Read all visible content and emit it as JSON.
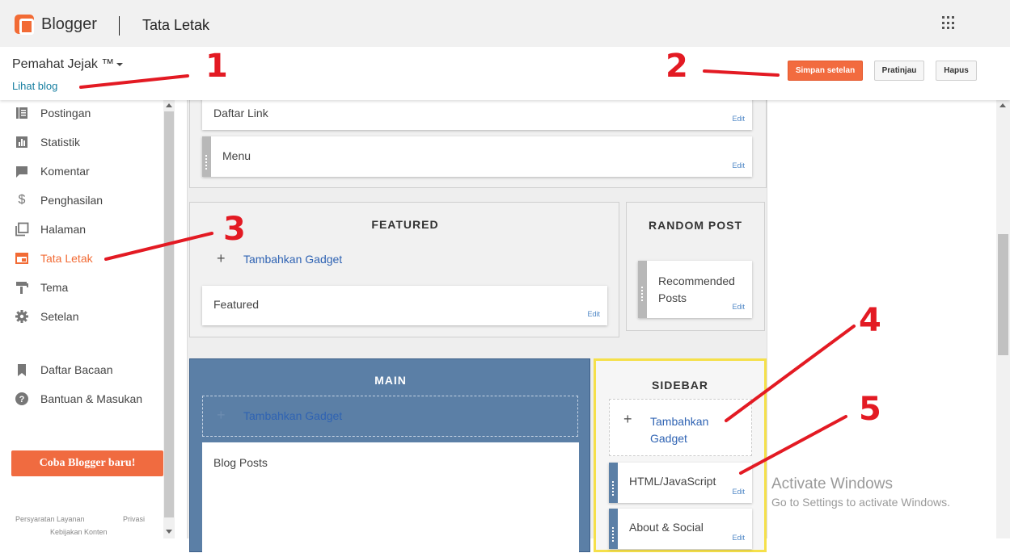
{
  "app": {
    "brand": "Blogger",
    "page_title": "Tata Letak"
  },
  "blog": {
    "name": "Pemahat Jejak ™",
    "view_link": "Lihat blog"
  },
  "actions": {
    "save": "Simpan setelan",
    "preview": "Pratinjau",
    "delete": "Hapus"
  },
  "nav": {
    "items": [
      {
        "label": "Postingan",
        "icon": "posts-icon"
      },
      {
        "label": "Statistik",
        "icon": "stats-icon"
      },
      {
        "label": "Komentar",
        "icon": "comments-icon"
      },
      {
        "label": "Penghasilan",
        "icon": "dollar-icon"
      },
      {
        "label": "Halaman",
        "icon": "pages-icon"
      },
      {
        "label": "Tata Letak",
        "icon": "layout-icon",
        "active": true
      },
      {
        "label": "Tema",
        "icon": "theme-icon"
      },
      {
        "label": "Setelan",
        "icon": "gear-icon"
      },
      {
        "label": "Daftar Bacaan",
        "icon": "bookmark-icon"
      },
      {
        "label": "Bantuan & Masukan",
        "icon": "help-icon"
      }
    ],
    "try_new": "Coba Blogger baru!",
    "footer": {
      "terms": "Persyaratan Layanan",
      "privacy": "Privasi",
      "content_policy": "Kebijakan Konten"
    }
  },
  "layout": {
    "top_gadgets": [
      {
        "label": "Daftar Link",
        "edit": "Edit"
      },
      {
        "label": "Menu",
        "edit": "Edit"
      }
    ],
    "featured": {
      "title": "FEATURED",
      "add": "Tambahkan Gadget",
      "gadget": "Featured",
      "edit": "Edit"
    },
    "random_post": {
      "title": "RANDOM POST",
      "gadget": "Recommended Posts",
      "edit": "Edit"
    },
    "main": {
      "title": "MAIN",
      "add": "Tambahkan Gadget",
      "gadget": "Blog Posts"
    },
    "sidebar": {
      "title": "SIDEBAR",
      "add": "Tambahkan Gadget",
      "gadgets": [
        {
          "label": "HTML/JavaScript",
          "edit": "Edit"
        },
        {
          "label": "About & Social",
          "edit": "Edit"
        }
      ]
    }
  },
  "watermark": {
    "line1": "Activate Windows",
    "line2": "Go to Settings to activate Windows."
  },
  "annotations": [
    "1",
    "2",
    "3",
    "4",
    "5"
  ],
  "colors": {
    "accent": "#f26b35",
    "annotation": "#e31a23",
    "main_section": "#5b7fa6",
    "highlight": "#f5e04a",
    "link": "#2f63b3"
  }
}
